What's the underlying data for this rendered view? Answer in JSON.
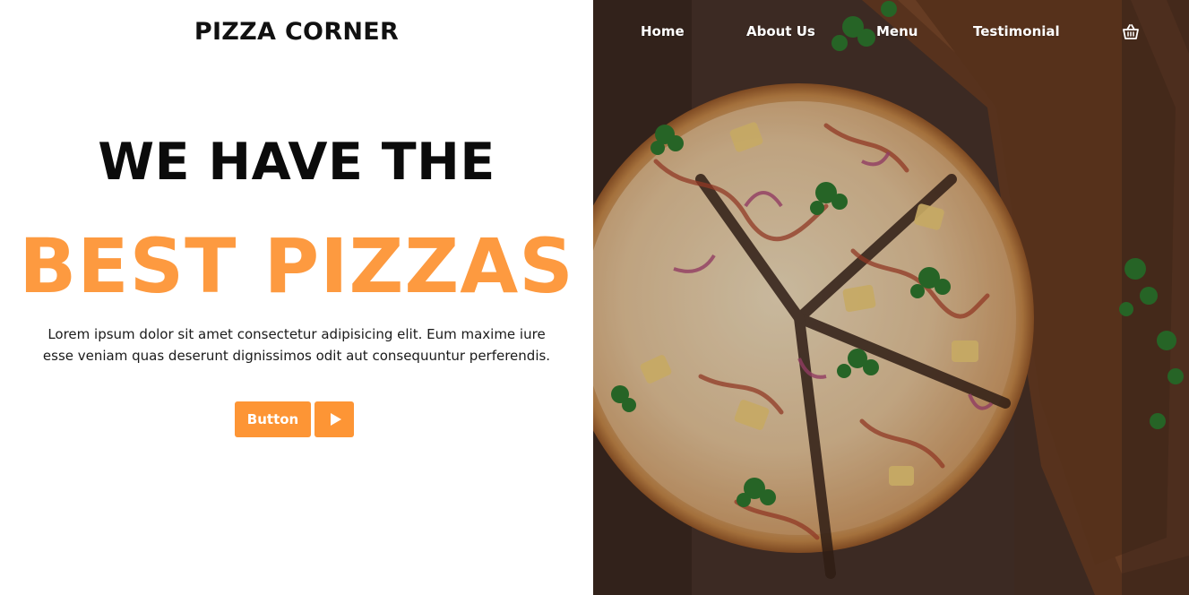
{
  "header": {
    "brand": "PIZZA CORNER"
  },
  "nav": {
    "items": [
      {
        "label": "Home"
      },
      {
        "label": "About Us"
      },
      {
        "label": "Menu"
      },
      {
        "label": "Testimonial"
      }
    ],
    "cart_icon": "basket-icon"
  },
  "hero": {
    "headline_line1": "WE HAVE THE",
    "headline_line2": "BEST PIZZAS",
    "description": "Lorem ipsum dolor sit amet consectetur adipisicing elit. Eum maxime iure esse veniam quas deserunt dignissimos odit aut consequuntur perferendis.",
    "primary_button": "Button",
    "play_icon": "play-icon",
    "image_subject": "pizza-on-wooden-board"
  },
  "colors": {
    "accent": "#fd9535",
    "headline_accent": "#fd9a40",
    "text_dark": "#0b0b0b",
    "nav_text": "#ffffff"
  }
}
